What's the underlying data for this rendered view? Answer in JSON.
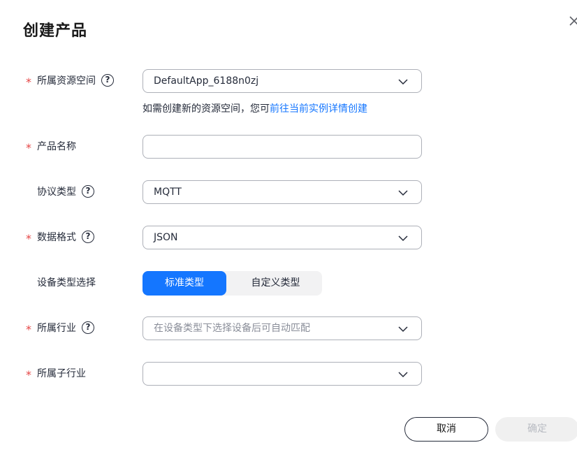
{
  "dialog": {
    "title": "创建产品"
  },
  "form": {
    "resource_space": {
      "label": "所属资源空间",
      "value": "DefaultApp_6188n0zj",
      "hint_text": "如需创建新的资源空间，您可",
      "hint_link": "前往当前实例详情创建"
    },
    "product_name": {
      "label": "产品名称",
      "value": ""
    },
    "protocol_type": {
      "label": "协议类型",
      "value": "MQTT"
    },
    "data_format": {
      "label": "数据格式",
      "value": "JSON"
    },
    "device_type": {
      "label": "设备类型选择",
      "options": [
        "标准类型",
        "自定义类型"
      ]
    },
    "industry": {
      "label": "所属行业",
      "placeholder": "在设备类型下选择设备后可自动匹配"
    },
    "sub_industry": {
      "label": "所属子行业",
      "value": ""
    }
  },
  "footer": {
    "cancel_label": "取消",
    "ok_label": "确定"
  },
  "icons": {
    "help": "?",
    "required": "*"
  }
}
